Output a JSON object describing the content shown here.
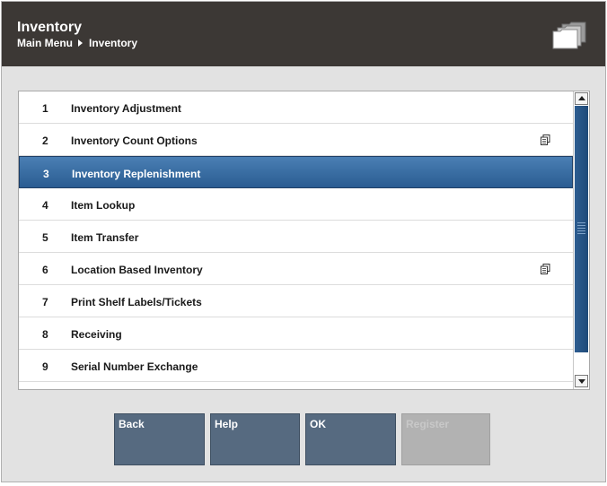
{
  "header": {
    "title": "Inventory",
    "breadcrumb": [
      "Main Menu",
      "Inventory"
    ],
    "icon": "folders-icon"
  },
  "menu": {
    "items": [
      {
        "number": "1",
        "label": "Inventory Adjustment",
        "has_doc_icon": false
      },
      {
        "number": "2",
        "label": "Inventory Count Options",
        "has_doc_icon": true
      },
      {
        "number": "3",
        "label": "Inventory Replenishment",
        "has_doc_icon": false,
        "selected": true
      },
      {
        "number": "4",
        "label": "Item Lookup",
        "has_doc_icon": false
      },
      {
        "number": "5",
        "label": "Item Transfer",
        "has_doc_icon": false
      },
      {
        "number": "6",
        "label": "Location Based Inventory",
        "has_doc_icon": true
      },
      {
        "number": "7",
        "label": "Print Shelf Labels/Tickets",
        "has_doc_icon": false
      },
      {
        "number": "8",
        "label": "Receiving",
        "has_doc_icon": false
      },
      {
        "number": "9",
        "label": "Serial Number Exchange",
        "has_doc_icon": false
      }
    ]
  },
  "buttons": {
    "back": "Back",
    "help": "Help",
    "ok": "OK",
    "register": "Register"
  },
  "colors": {
    "header_bg": "#3c3835",
    "selected_row": "#2f6399",
    "button_bg": "#566a80",
    "button_disabled": "#b2b2b2"
  }
}
